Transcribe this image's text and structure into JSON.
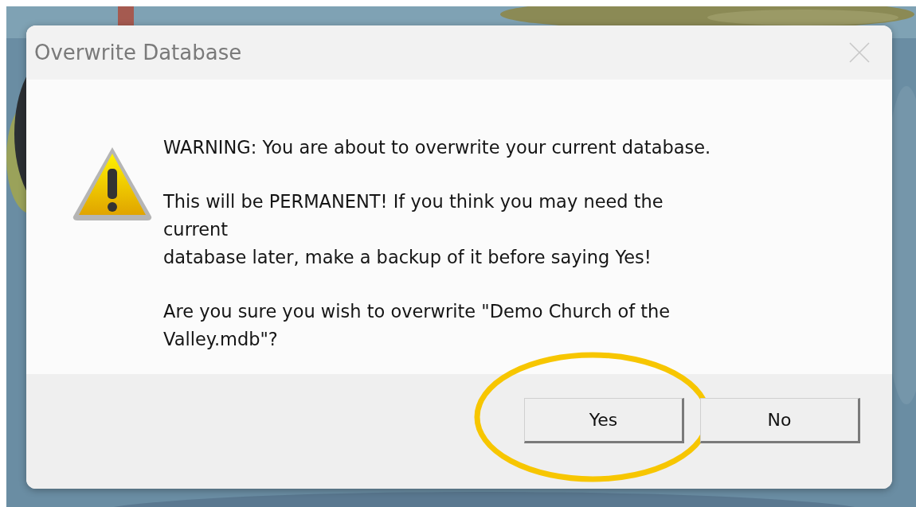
{
  "dialog": {
    "title": "Overwrite Database",
    "message": [
      [
        "WARNING: You are about to overwrite your current database."
      ],
      [
        "This will be PERMANENT! If you think you may need the",
        "current",
        "database later, make a backup of it before saying Yes!"
      ],
      [
        "Are you sure you wish to overwrite \"Demo Church of the",
        "Valley.mdb\"?"
      ]
    ],
    "buttons": [
      {
        "label": "Yes",
        "highlighted": true
      },
      {
        "label": "No",
        "highlighted": false
      }
    ]
  }
}
